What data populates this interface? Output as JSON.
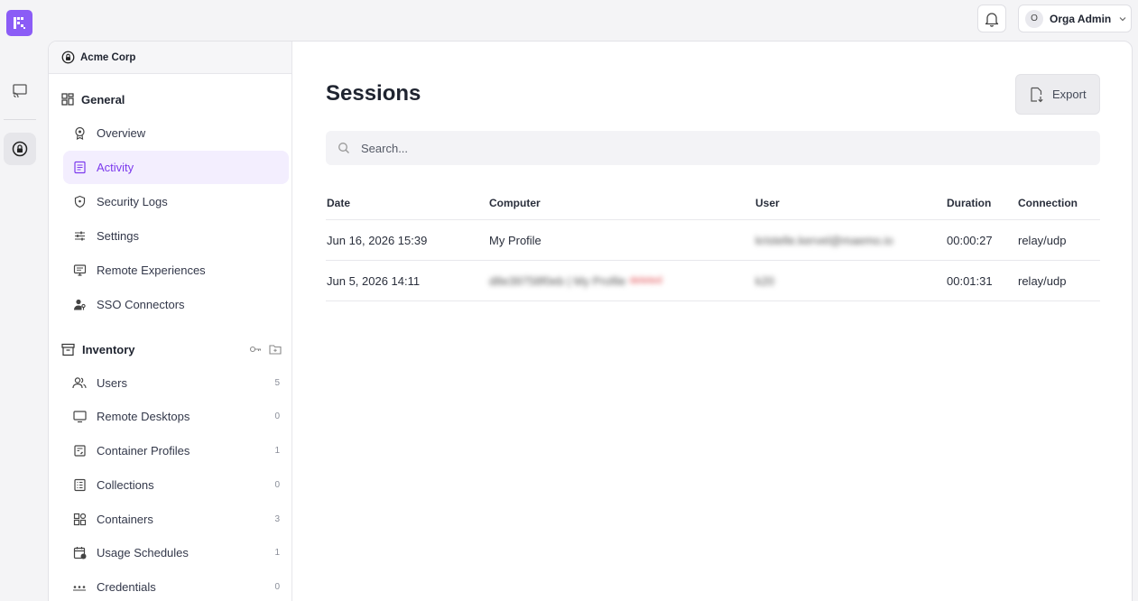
{
  "topbar": {
    "user_initial": "O",
    "user_name": "Orga Admin"
  },
  "sidebar": {
    "org_name": "Acme Corp",
    "general": {
      "title": "General",
      "items": [
        {
          "label": "Overview",
          "icon": "award-icon"
        },
        {
          "label": "Activity",
          "icon": "document-list-icon",
          "active": true
        },
        {
          "label": "Security Logs",
          "icon": "shield-icon"
        },
        {
          "label": "Settings",
          "icon": "sliders-icon"
        },
        {
          "label": "Remote Experiences",
          "icon": "monitor-icon"
        },
        {
          "label": "SSO Connectors",
          "icon": "user-key-icon"
        }
      ]
    },
    "inventory": {
      "title": "Inventory",
      "items": [
        {
          "label": "Users",
          "count": "5"
        },
        {
          "label": "Remote Desktops",
          "count": "0"
        },
        {
          "label": "Container Profiles",
          "count": "1"
        },
        {
          "label": "Collections",
          "count": "0"
        },
        {
          "label": "Containers",
          "count": "3"
        },
        {
          "label": "Usage Schedules",
          "count": "1"
        },
        {
          "label": "Credentials",
          "count": "0"
        }
      ]
    }
  },
  "main": {
    "title": "Sessions",
    "export_label": "Export",
    "search_placeholder": "Search...",
    "columns": [
      "Date",
      "Computer",
      "User",
      "Duration",
      "Connection"
    ],
    "rows": [
      {
        "date": "Jun 16, 2026 15:39",
        "computer": "My Profile",
        "computer_extra": "",
        "user": "kristelle.kervel@maemo.io",
        "duration": "00:00:27",
        "connection": "relay/udp"
      },
      {
        "date": "Jun 5, 2026 14:11",
        "computer": "d8e39758f0eb | My Profile",
        "computer_extra": "deleted",
        "user": "k20",
        "duration": "00:01:31",
        "connection": "relay/udp"
      }
    ]
  },
  "colors": {
    "brand": "#8b5cf6",
    "active_text": "#7c3aed",
    "active_bg": "#f3eefe"
  }
}
